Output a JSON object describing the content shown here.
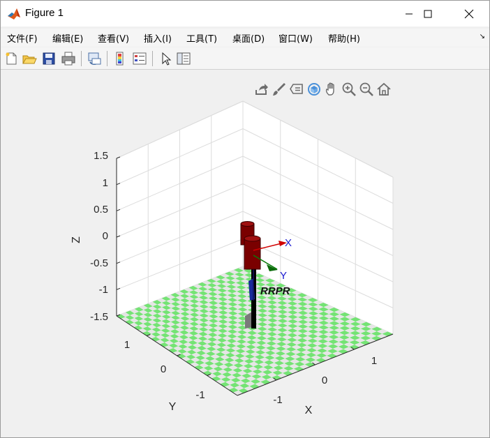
{
  "window": {
    "title": "Figure 1",
    "accent": "#0072bd"
  },
  "menu": {
    "items": [
      {
        "label": "文件(F)"
      },
      {
        "label": "编辑(E)"
      },
      {
        "label": "查看(V)"
      },
      {
        "label": "插入(I)"
      },
      {
        "label": "工具(T)"
      },
      {
        "label": "桌面(D)"
      },
      {
        "label": "窗口(W)"
      },
      {
        "label": "帮助(H)"
      }
    ]
  },
  "toolbar": {
    "icons": [
      "new-figure-icon",
      "open-file-icon",
      "save-icon",
      "print-icon",
      "link-plot-icon",
      "insert-colorbar-icon",
      "insert-legend-icon",
      "edit-plot-icon",
      "property-inspector-icon"
    ]
  },
  "axes_toolbar": {
    "icons": [
      "export-icon",
      "brush-icon",
      "data-tips-icon",
      "rotate-3d-icon",
      "pan-icon",
      "zoom-in-icon",
      "zoom-out-icon",
      "restore-view-icon"
    ]
  },
  "plot": {
    "z_label": "Z",
    "y_label": "Y",
    "x_label": "X",
    "z_ticks": [
      "1.5",
      "1",
      "0.5",
      "0",
      "-0.5",
      "-1",
      "-1.5"
    ],
    "y_ticks": [
      "1",
      "0",
      "-1"
    ],
    "x_ticks": [
      "-1",
      "0",
      "1"
    ],
    "robot_name": "RRPR",
    "frame_x": "X",
    "frame_y": "Y",
    "floor_color_1": "#74e374",
    "floor_color_2": "#e6e6e6",
    "link_color": "#7a0000"
  }
}
